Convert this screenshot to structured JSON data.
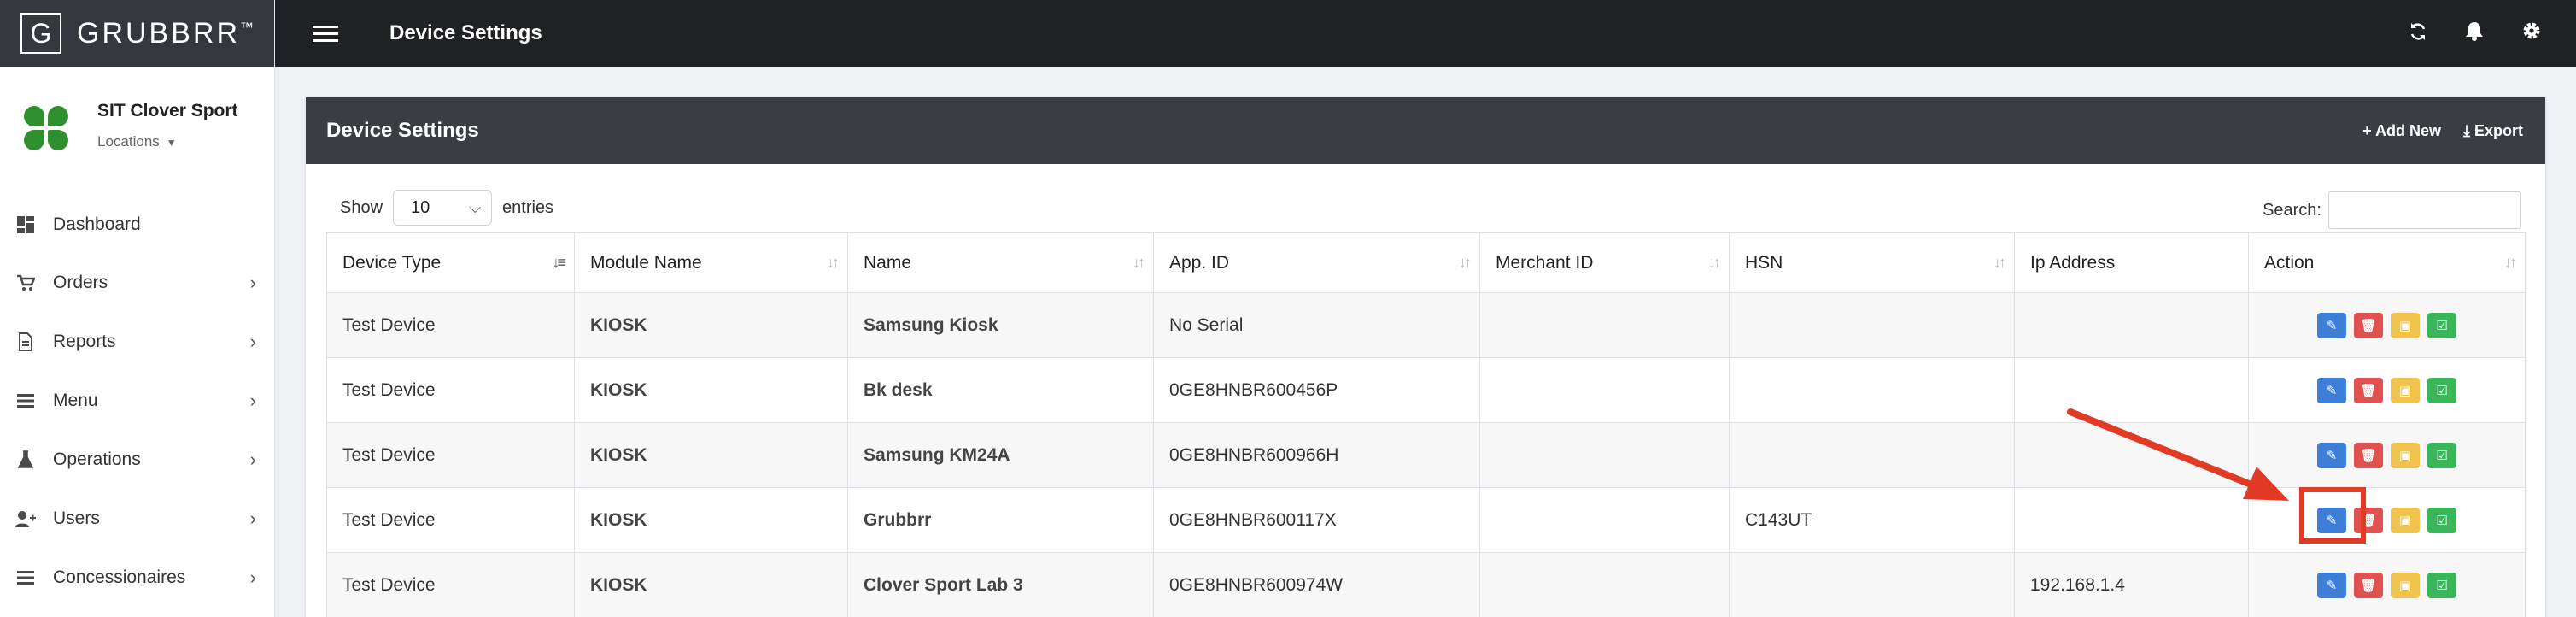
{
  "brand": {
    "letter": "G",
    "name": "GRUBBRR",
    "tm": "™"
  },
  "store": {
    "name": "SIT Clover Sport",
    "locations_label": "Locations"
  },
  "sidebar": {
    "items": [
      {
        "label": "Dashboard",
        "icon": "dashboard-icon",
        "has_children": false
      },
      {
        "label": "Orders",
        "icon": "cart-icon",
        "has_children": true
      },
      {
        "label": "Reports",
        "icon": "report-icon",
        "has_children": true
      },
      {
        "label": "Menu",
        "icon": "menu-list-icon",
        "has_children": true
      },
      {
        "label": "Operations",
        "icon": "flask-icon",
        "has_children": true
      },
      {
        "label": "Users",
        "icon": "user-add-icon",
        "has_children": true
      },
      {
        "label": "Concessionaires",
        "icon": "list-icon",
        "has_children": true
      }
    ]
  },
  "topbar": {
    "title": "Device Settings",
    "icons": [
      "refresh-icon",
      "bell-icon",
      "gear-icon"
    ]
  },
  "card": {
    "title": "Device Settings",
    "add_new_label": "Add New",
    "export_label": "Export"
  },
  "controls": {
    "show_label": "Show",
    "entries_value": "10",
    "entries_label": "entries",
    "search_label": "Search:",
    "search_value": ""
  },
  "table": {
    "headers": [
      "Device Type",
      "Module Name",
      "Name",
      "App. ID",
      "Merchant ID",
      "HSN",
      "Ip Address",
      "Action"
    ],
    "rows": [
      {
        "device_type": "Test Device",
        "module": "KIOSK",
        "name": "Samsung Kiosk",
        "app_id": "No Serial",
        "merchant_id": "",
        "hsn": "",
        "ip": ""
      },
      {
        "device_type": "Test Device",
        "module": "KIOSK",
        "name": "Bk desk",
        "app_id": "0GE8HNBR600456P",
        "merchant_id": "",
        "hsn": "",
        "ip": ""
      },
      {
        "device_type": "Test Device",
        "module": "KIOSK",
        "name": "Samsung KM24A",
        "app_id": "0GE8HNBR600966H",
        "merchant_id": "",
        "hsn": "",
        "ip": ""
      },
      {
        "device_type": "Test Device",
        "module": "KIOSK",
        "name": "Grubbrr",
        "app_id": "0GE8HNBR600117X",
        "merchant_id": "",
        "hsn": "C143UT",
        "ip": ""
      },
      {
        "device_type": "Test Device",
        "module": "KIOSK",
        "name": "Clover Sport Lab 3",
        "app_id": "0GE8HNBR600974W",
        "merchant_id": "",
        "hsn": "",
        "ip": "192.168.1.4"
      }
    ]
  },
  "colors": {
    "edit": "#3d7fd6",
    "delete": "#e05252",
    "device": "#f0c24e",
    "confirm": "#3bb55a",
    "annotation": "#e13a25"
  }
}
